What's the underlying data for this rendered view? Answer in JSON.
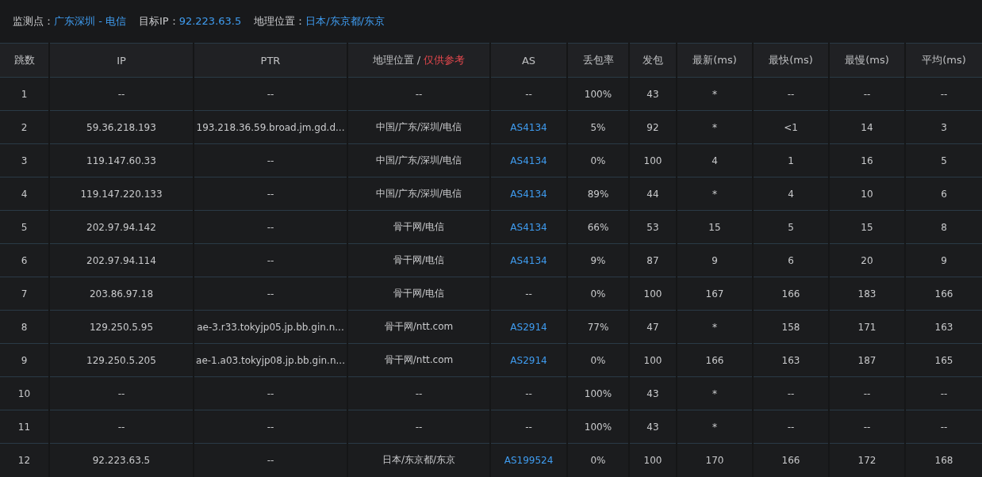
{
  "summary": [
    {
      "label": "监测点：",
      "value": "广东深圳 - 电信"
    },
    {
      "label": "目标IP：",
      "value": "92.223.63.5"
    },
    {
      "label": "地理位置：",
      "value": "日本/东京都/东京"
    }
  ],
  "table": {
    "columns": [
      {
        "label": "跳数"
      },
      {
        "label": "IP"
      },
      {
        "label": "PTR"
      },
      {
        "label": "地理位置 / ",
        "note": "仅供参考"
      },
      {
        "label": "AS"
      },
      {
        "label": "丢包率"
      },
      {
        "label": "发包"
      },
      {
        "label": "最新(ms)"
      },
      {
        "label": "最快(ms)"
      },
      {
        "label": "最慢(ms)"
      },
      {
        "label": "平均(ms)"
      }
    ],
    "rows": [
      {
        "hop": "1",
        "ip": "--",
        "ptr": "--",
        "geo": "--",
        "as": {
          "text": "--",
          "link": false
        },
        "loss": "100%",
        "sent": "43",
        "last": "*",
        "best": "--",
        "worst": "--",
        "avg": "--"
      },
      {
        "hop": "2",
        "ip": "59.36.218.193",
        "ptr": "193.218.36.59.broad.jm.gd.d...",
        "geo": "中国/广东/深圳/电信",
        "as": {
          "text": "AS4134",
          "link": true
        },
        "loss": "5%",
        "sent": "92",
        "last": "*",
        "best": "<1",
        "worst": "14",
        "avg": "3"
      },
      {
        "hop": "3",
        "ip": "119.147.60.33",
        "ptr": "--",
        "geo": "中国/广东/深圳/电信",
        "as": {
          "text": "AS4134",
          "link": true
        },
        "loss": "0%",
        "sent": "100",
        "last": "4",
        "best": "1",
        "worst": "16",
        "avg": "5"
      },
      {
        "hop": "4",
        "ip": "119.147.220.133",
        "ptr": "--",
        "geo": "中国/广东/深圳/电信",
        "as": {
          "text": "AS4134",
          "link": true
        },
        "loss": "89%",
        "sent": "44",
        "last": "*",
        "best": "4",
        "worst": "10",
        "avg": "6"
      },
      {
        "hop": "5",
        "ip": "202.97.94.142",
        "ptr": "--",
        "geo": "骨干网/电信",
        "as": {
          "text": "AS4134",
          "link": true
        },
        "loss": "66%",
        "sent": "53",
        "last": "15",
        "best": "5",
        "worst": "15",
        "avg": "8"
      },
      {
        "hop": "6",
        "ip": "202.97.94.114",
        "ptr": "--",
        "geo": "骨干网/电信",
        "as": {
          "text": "AS4134",
          "link": true
        },
        "loss": "9%",
        "sent": "87",
        "last": "9",
        "best": "6",
        "worst": "20",
        "avg": "9"
      },
      {
        "hop": "7",
        "ip": "203.86.97.18",
        "ptr": "--",
        "geo": "骨干网/电信",
        "as": {
          "text": "--",
          "link": false
        },
        "loss": "0%",
        "sent": "100",
        "last": "167",
        "best": "166",
        "worst": "183",
        "avg": "166"
      },
      {
        "hop": "8",
        "ip": "129.250.5.95",
        "ptr": "ae-3.r33.tokyjp05.jp.bb.gin.n...",
        "geo": "骨干网/ntt.com",
        "as": {
          "text": "AS2914",
          "link": true
        },
        "loss": "77%",
        "sent": "47",
        "last": "*",
        "best": "158",
        "worst": "171",
        "avg": "163"
      },
      {
        "hop": "9",
        "ip": "129.250.5.205",
        "ptr": "ae-1.a03.tokyjp08.jp.bb.gin.n...",
        "geo": "骨干网/ntt.com",
        "as": {
          "text": "AS2914",
          "link": true
        },
        "loss": "0%",
        "sent": "100",
        "last": "166",
        "best": "163",
        "worst": "187",
        "avg": "165"
      },
      {
        "hop": "10",
        "ip": "--",
        "ptr": "--",
        "geo": "--",
        "as": {
          "text": "--",
          "link": false
        },
        "loss": "100%",
        "sent": "43",
        "last": "*",
        "best": "--",
        "worst": "--",
        "avg": "--"
      },
      {
        "hop": "11",
        "ip": "--",
        "ptr": "--",
        "geo": "--",
        "as": {
          "text": "--",
          "link": false
        },
        "loss": "100%",
        "sent": "43",
        "last": "*",
        "best": "--",
        "worst": "--",
        "avg": "--"
      },
      {
        "hop": "12",
        "ip": "92.223.63.5",
        "ptr": "--",
        "geo": "日本/东京都/东京",
        "as": {
          "text": "AS199524",
          "link": true
        },
        "loss": "0%",
        "sent": "100",
        "last": "170",
        "best": "166",
        "worst": "172",
        "avg": "168"
      }
    ]
  }
}
